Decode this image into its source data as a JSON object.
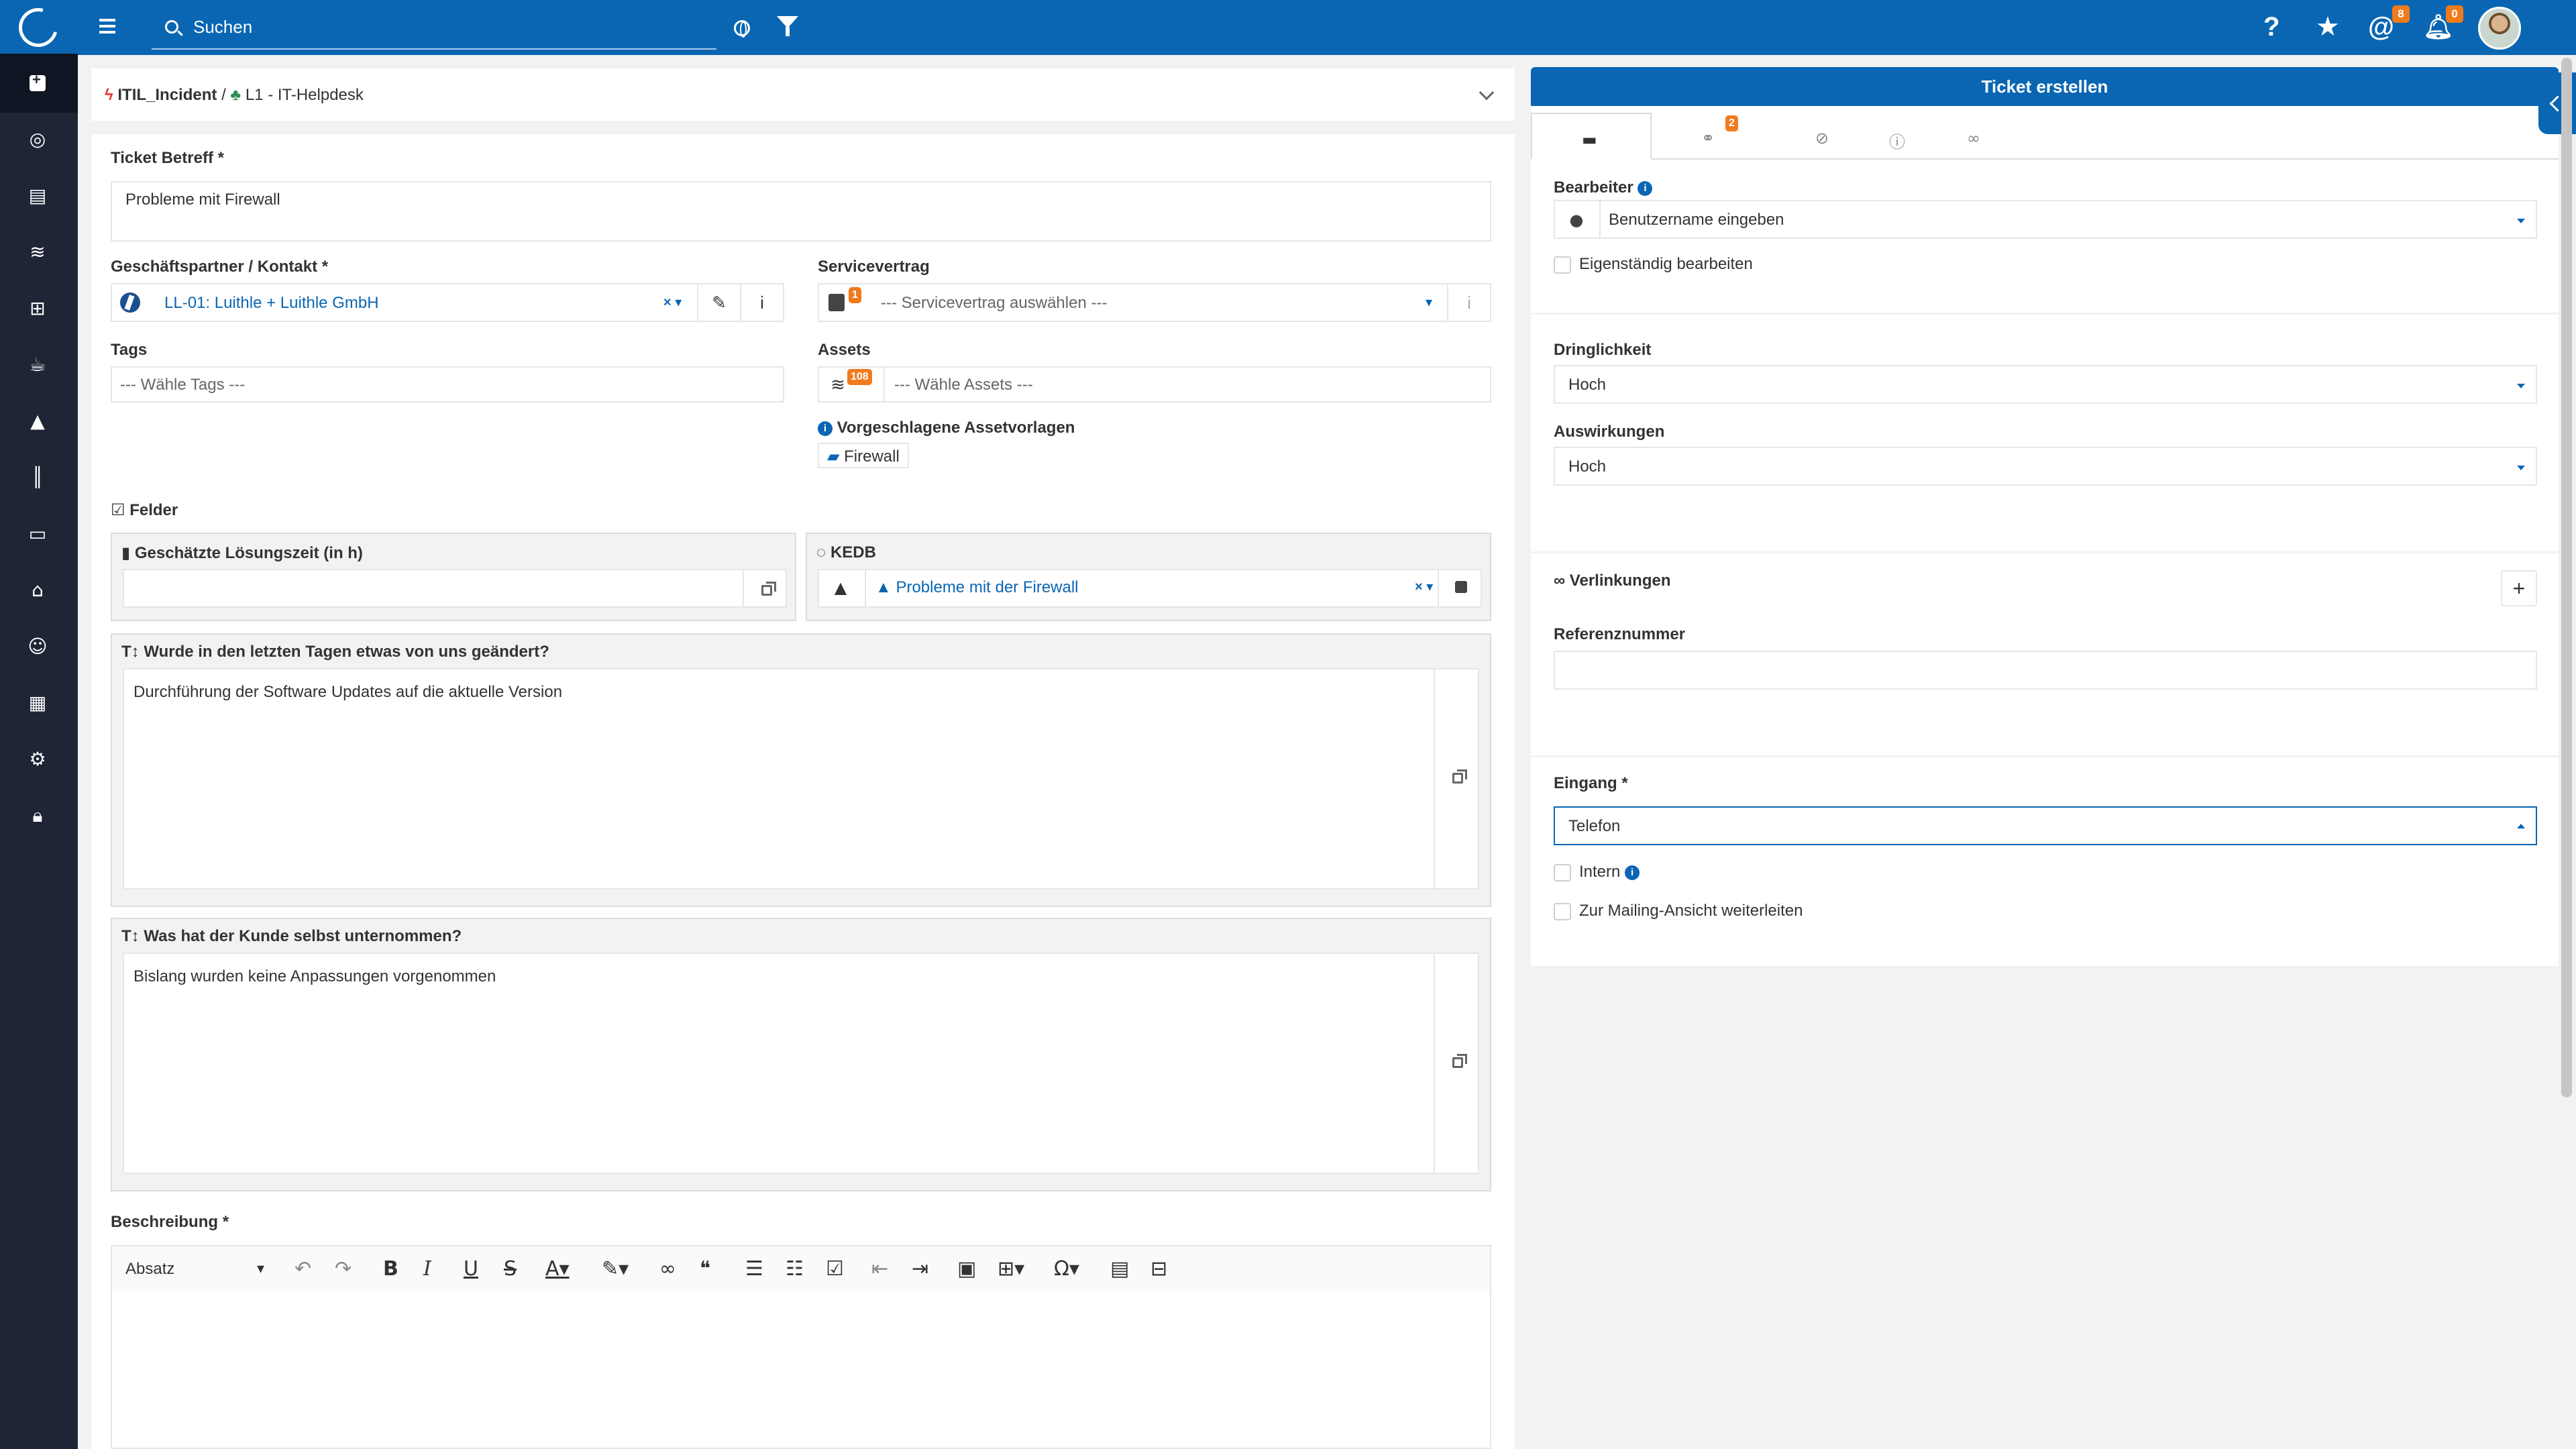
{
  "topbar": {
    "search_placeholder": "Suchen",
    "badges": {
      "mentions": "8",
      "notifications": "0"
    },
    "icons": [
      "menu-icon",
      "search-icon",
      "globe-icon",
      "filter-icon",
      "help-icon",
      "star-icon",
      "at-icon",
      "bell-icon"
    ]
  },
  "breadcrumb": {
    "type": "ITIL_Incident",
    "separator": "/",
    "group": "L1 - IT-Helpdesk"
  },
  "ticket": {
    "subject_label": "Ticket Betreff *",
    "subject_value": "Probleme mit Firewall",
    "partner_label": "Geschäftspartner / Kontakt *",
    "partner_value": "LL-01: Luithle + Luithle GmbH",
    "contract_label": "Servicevertrag",
    "contract_placeholder": "--- Servicevertrag auswählen ---",
    "contract_badge": "1",
    "tags_label": "Tags",
    "tags_placeholder": "--- Wähle Tags ---",
    "assets_label": "Assets",
    "assets_badge": "108",
    "assets_placeholder": "--- Wähle Assets ---",
    "suggested_label": "Vorgeschlagene Assetvorlagen",
    "suggested_chip": "Firewall"
  },
  "fields_section": {
    "title": "Felder",
    "estimate_label": "Geschätzte Lösungszeit (in h)",
    "estimate_value": "",
    "kedb_label": "KEDB",
    "kedb_value": "Probleme mit der Firewall",
    "q1_label": "Wurde in den letzten Tagen etwas von uns geändert?",
    "q1_value": "Durchführung der Software Updates auf die aktuelle Version",
    "q2_label": "Was hat der Kunde selbst unternommen?",
    "q2_value": "Bislang wurden keine Anpassungen vorgenommen"
  },
  "description": {
    "label": "Beschreibung *",
    "style_select": "Absatz",
    "toolbar_icons": [
      "undo-icon",
      "redo-icon",
      "bold-icon",
      "italic-icon",
      "underline-icon",
      "strikethrough-icon",
      "font-color-icon",
      "highlight-icon",
      "link-icon",
      "quote-icon",
      "numbered-list-icon",
      "bulleted-list-icon",
      "todo-list-icon",
      "outdent-icon",
      "indent-icon",
      "image-icon",
      "table-icon",
      "special-char-icon",
      "template-icon",
      "collapse-icon"
    ]
  },
  "right": {
    "create_button": "Ticket erstellen",
    "tab_badge": "2",
    "assignee_label": "Bearbeiter",
    "assignee_placeholder": "Benutzername eingeben",
    "self_edit_label": "Eigenständig bearbeiten",
    "urgency_label": "Dringlichkeit",
    "urgency_value": "Hoch",
    "impact_label": "Auswirkungen",
    "impact_value": "Hoch",
    "links_label": "Verlinkungen",
    "reference_label": "Referenznummer",
    "reference_value": "",
    "channel_label": "Eingang *",
    "channel_value": "Telefon",
    "internal_label": "Intern",
    "mailing_label": "Zur Mailing-Ansicht weiterleiten"
  },
  "colors": {
    "primary": "#0a66b3",
    "sidebar": "#1e2636",
    "badge": "#f07b1d"
  }
}
